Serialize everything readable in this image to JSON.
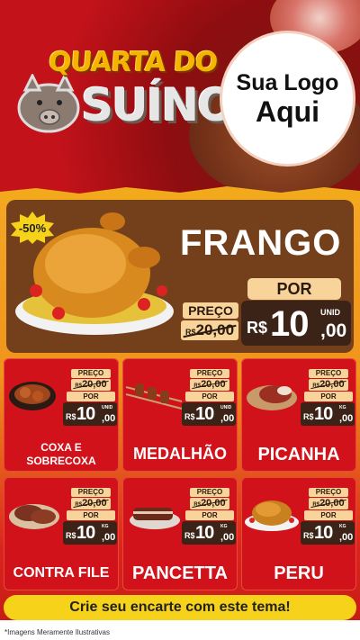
{
  "header": {
    "title_line1": "QUARTA DO",
    "title_line2": "SUÍNO",
    "logo_line1": "Sua Logo",
    "logo_line2": "Aqui"
  },
  "featured": {
    "name": "FRANGO",
    "discount": "-50%",
    "preco_label": "PREÇO",
    "old_currency": "R$",
    "old_price": "20,00",
    "por_label": "POR",
    "currency": "R$",
    "price_int": "10",
    "price_dec": ",00",
    "unit": "UNID"
  },
  "products": [
    {
      "name": "COXA E SOBRECOXA",
      "preco_label": "PREÇO",
      "old_currency": "R$",
      "old_price": "20,00",
      "por_label": "POR",
      "currency": "R$",
      "price_int": "10",
      "price_dec": ",00",
      "unit": "UNID"
    },
    {
      "name": "MEDALHÃO",
      "preco_label": "PREÇO",
      "old_currency": "R$",
      "old_price": "20,00",
      "por_label": "POR",
      "currency": "R$",
      "price_int": "10",
      "price_dec": ",00",
      "unit": "UNID"
    },
    {
      "name": "PICANHA",
      "preco_label": "PREÇO",
      "old_currency": "R$",
      "old_price": "20,00",
      "por_label": "POR",
      "currency": "R$",
      "price_int": "10",
      "price_dec": ",00",
      "unit": "KG"
    },
    {
      "name": "CONTRA FILE",
      "preco_label": "PREÇO",
      "old_currency": "R$",
      "old_price": "20,00",
      "por_label": "POR",
      "currency": "R$",
      "price_int": "10",
      "price_dec": ",00",
      "unit": "KG"
    },
    {
      "name": "PANCETTA",
      "preco_label": "PREÇO",
      "old_currency": "R$",
      "old_price": "20,00",
      "por_label": "POR",
      "currency": "R$",
      "price_int": "10",
      "price_dec": ",00",
      "unit": "KG"
    },
    {
      "name": "PERU",
      "preco_label": "PREÇO",
      "old_currency": "R$",
      "old_price": "20,00",
      "por_label": "POR",
      "currency": "R$",
      "price_int": "10",
      "price_dec": ",00",
      "unit": "KG"
    }
  ],
  "cta": "Crie seu encarte com este tema!",
  "footer_note": "*Imagens Meramente Ilustrativas",
  "colors": {
    "red": "#d2121a",
    "yellow": "#f6d21a",
    "brown": "#74401c",
    "cream": "#f8d49a",
    "orange": "#f5a623"
  }
}
